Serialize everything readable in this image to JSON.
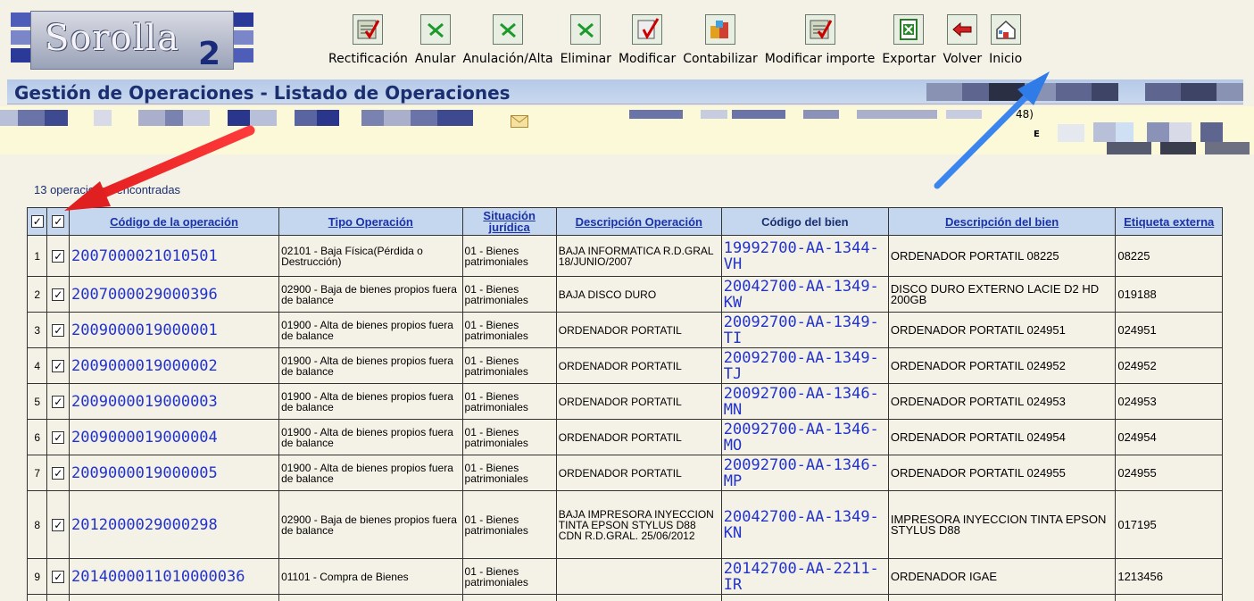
{
  "app": {
    "logo_text": "Sorolla",
    "logo_sub": "2"
  },
  "toolbar": [
    {
      "label": "Rectificación",
      "icon": "rectify-icon"
    },
    {
      "label": "Anular",
      "icon": "cancel-icon"
    },
    {
      "label": "Anulación/Alta",
      "icon": "cancel-register-icon"
    },
    {
      "label": "Eliminar",
      "icon": "delete-icon"
    },
    {
      "label": "Modificar",
      "icon": "edit-icon"
    },
    {
      "label": "Contabilizar",
      "icon": "accounting-icon"
    },
    {
      "label": "Modificar importe",
      "icon": "edit-amount-icon"
    },
    {
      "label": "Exportar",
      "icon": "excel-export-icon"
    },
    {
      "label": "Volver",
      "icon": "back-arrow-icon"
    },
    {
      "label": "Inicio",
      "icon": "home-icon"
    }
  ],
  "page": {
    "title": "Gestión de Operaciones - Listado de Operaciones"
  },
  "info": {
    "partial_1": "48)",
    "partial_2": "E"
  },
  "results": {
    "count_label": "13 operaciones encontradas"
  },
  "table": {
    "headers": [
      "Código de la operación",
      "Tipo Operación",
      "Situación jurídica",
      "Descripción Operación",
      "Código del bien",
      "Descripción del bien",
      "Etiqueta externa"
    ],
    "rows": [
      {
        "n": "1",
        "code": "2007000021010501",
        "tipo": "02101 - Baja Física(Pérdida o Destrucción)",
        "sit": "01 - Bienes patrimoniales",
        "desc": "BAJA INFORMATICA R.D.GRAL 18/JUNIO/2007",
        "bien": "19992700-AA-1344-VH",
        "bdesc": "ORDENADOR PORTATIL 08225",
        "etq": "08225"
      },
      {
        "n": "2",
        "code": "2007000029000396",
        "tipo": "02900 - Baja de bienes propios fuera de balance",
        "sit": "01 - Bienes patrimoniales",
        "desc": "BAJA DISCO DURO",
        "bien": "20042700-AA-1349-KW",
        "bdesc": "DISCO DURO EXTERNO LACIE D2 HD 200GB",
        "etq": "019188"
      },
      {
        "n": "3",
        "code": "2009000019000001",
        "tipo": "01900 - Alta de bienes propios fuera de balance",
        "sit": "01 - Bienes patrimoniales",
        "desc": "ORDENADOR PORTATIL",
        "bien": "20092700-AA-1349-TI",
        "bdesc": "ORDENADOR PORTATIL 024951",
        "etq": "024951"
      },
      {
        "n": "4",
        "code": "2009000019000002",
        "tipo": "01900 - Alta de bienes propios fuera de balance",
        "sit": "01 - Bienes patrimoniales",
        "desc": "ORDENADOR PORTATIL",
        "bien": "20092700-AA-1349-TJ",
        "bdesc": "ORDENADOR PORTATIL 024952",
        "etq": "024952"
      },
      {
        "n": "5",
        "code": "2009000019000003",
        "tipo": "01900 - Alta de bienes propios fuera de balance",
        "sit": "01 - Bienes patrimoniales",
        "desc": "ORDENADOR PORTATIL",
        "bien": "20092700-AA-1346-MN",
        "bdesc": "ORDENADOR PORTATIL 024953",
        "etq": "024953"
      },
      {
        "n": "6",
        "code": "2009000019000004",
        "tipo": "01900 - Alta de bienes propios fuera de balance",
        "sit": "01 - Bienes patrimoniales",
        "desc": "ORDENADOR PORTATIL",
        "bien": "20092700-AA-1346-MO",
        "bdesc": "ORDENADOR PORTATIL 024954",
        "etq": "024954"
      },
      {
        "n": "7",
        "code": "2009000019000005",
        "tipo": "01900 - Alta de bienes propios fuera de balance",
        "sit": "01 - Bienes patrimoniales",
        "desc": "ORDENADOR PORTATIL",
        "bien": "20092700-AA-1346-MP",
        "bdesc": "ORDENADOR PORTATIL 024955",
        "etq": "024955"
      },
      {
        "n": "8",
        "code": "2012000029000298",
        "tipo": "02900 - Baja de bienes propios fuera de balance",
        "sit": "01 - Bienes patrimoniales",
        "desc": "BAJA IMPRESORA INYECCION TINTA EPSON STYLUS D88 CDN R.D.GRAL. 25/06/2012",
        "bien": "20042700-AA-1349-KN",
        "bdesc": "IMPRESORA INYECCION TINTA EPSON STYLUS D88",
        "etq": "017195"
      },
      {
        "n": "9",
        "code": "2014000011010000036",
        "tipo": "01101 - Compra de Bienes",
        "sit": "01 - Bienes patrimoniales",
        "desc": "",
        "bien": "20142700-AA-2211-IR",
        "bdesc": "ORDENADOR IGAE",
        "etq": "1213456"
      }
    ]
  },
  "colors": {
    "title_text": "#1b2f70",
    "link": "#2233cc",
    "header_bg": "#c5d6ef",
    "annotation_red": "#e02020",
    "annotation_blue": "#2f7be8"
  }
}
